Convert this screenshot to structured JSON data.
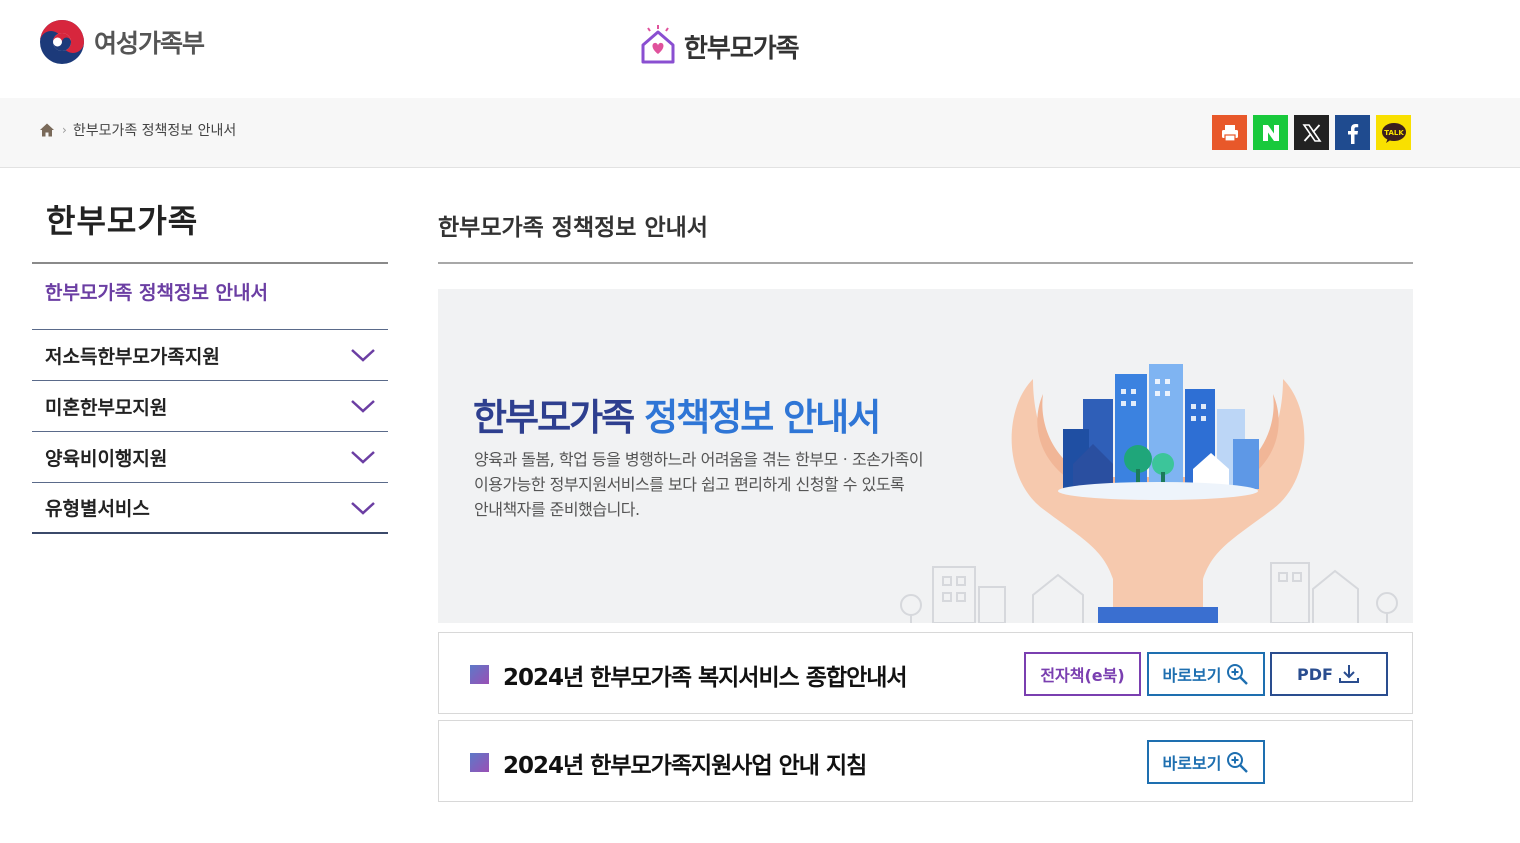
{
  "header": {
    "gov_name": "여성가족부",
    "site_name": "한부모가족"
  },
  "breadcrumb": {
    "current": "한부모가족 정책정보 안내서"
  },
  "share": {
    "buttons": [
      {
        "name": "print",
        "color": "#e8582a"
      },
      {
        "name": "naver",
        "color": "#19c93c"
      },
      {
        "name": "x",
        "color": "#222222"
      },
      {
        "name": "facebook",
        "color": "#1f4b8f"
      },
      {
        "name": "kakaotalk",
        "color": "#f9e000",
        "label": "TALK"
      }
    ]
  },
  "sidebar": {
    "title": "한부모가족",
    "items": [
      {
        "label": "한부모가족 정책정보 안내서",
        "active": true
      },
      {
        "label": "저소득한부모가족지원"
      },
      {
        "label": "미혼한부모지원"
      },
      {
        "label": "양육비이행지원"
      },
      {
        "label": "유형별서비스"
      }
    ]
  },
  "main": {
    "page_title": "한부모가족 정책정보 안내서",
    "banner": {
      "title_part1": "한부모가족 ",
      "title_part2": "정책정보 안내서",
      "desc_line1": "양육과 돌봄, 학업 등을 병행하느라 어려움을 겪는 한부모ㆍ조손가족이",
      "desc_line2": "이용가능한 정부지원서비스를 보다 쉽고 편리하게 신청할 수 있도록",
      "desc_line3": "안내책자를 준비했습니다."
    },
    "documents": [
      {
        "title": "2024년 한부모가족 복지서비스 종합안내서",
        "ebook": "전자책(e북)",
        "view": "바로보기",
        "pdf": "PDF"
      },
      {
        "title": "2024년 한부모가족지원사업 안내 지침",
        "view": "바로보기"
      }
    ]
  },
  "colors": {
    "accent_purple": "#6b3ea3",
    "accent_blue": "#1e6fb0",
    "banner_title": "#2e3f8f"
  }
}
